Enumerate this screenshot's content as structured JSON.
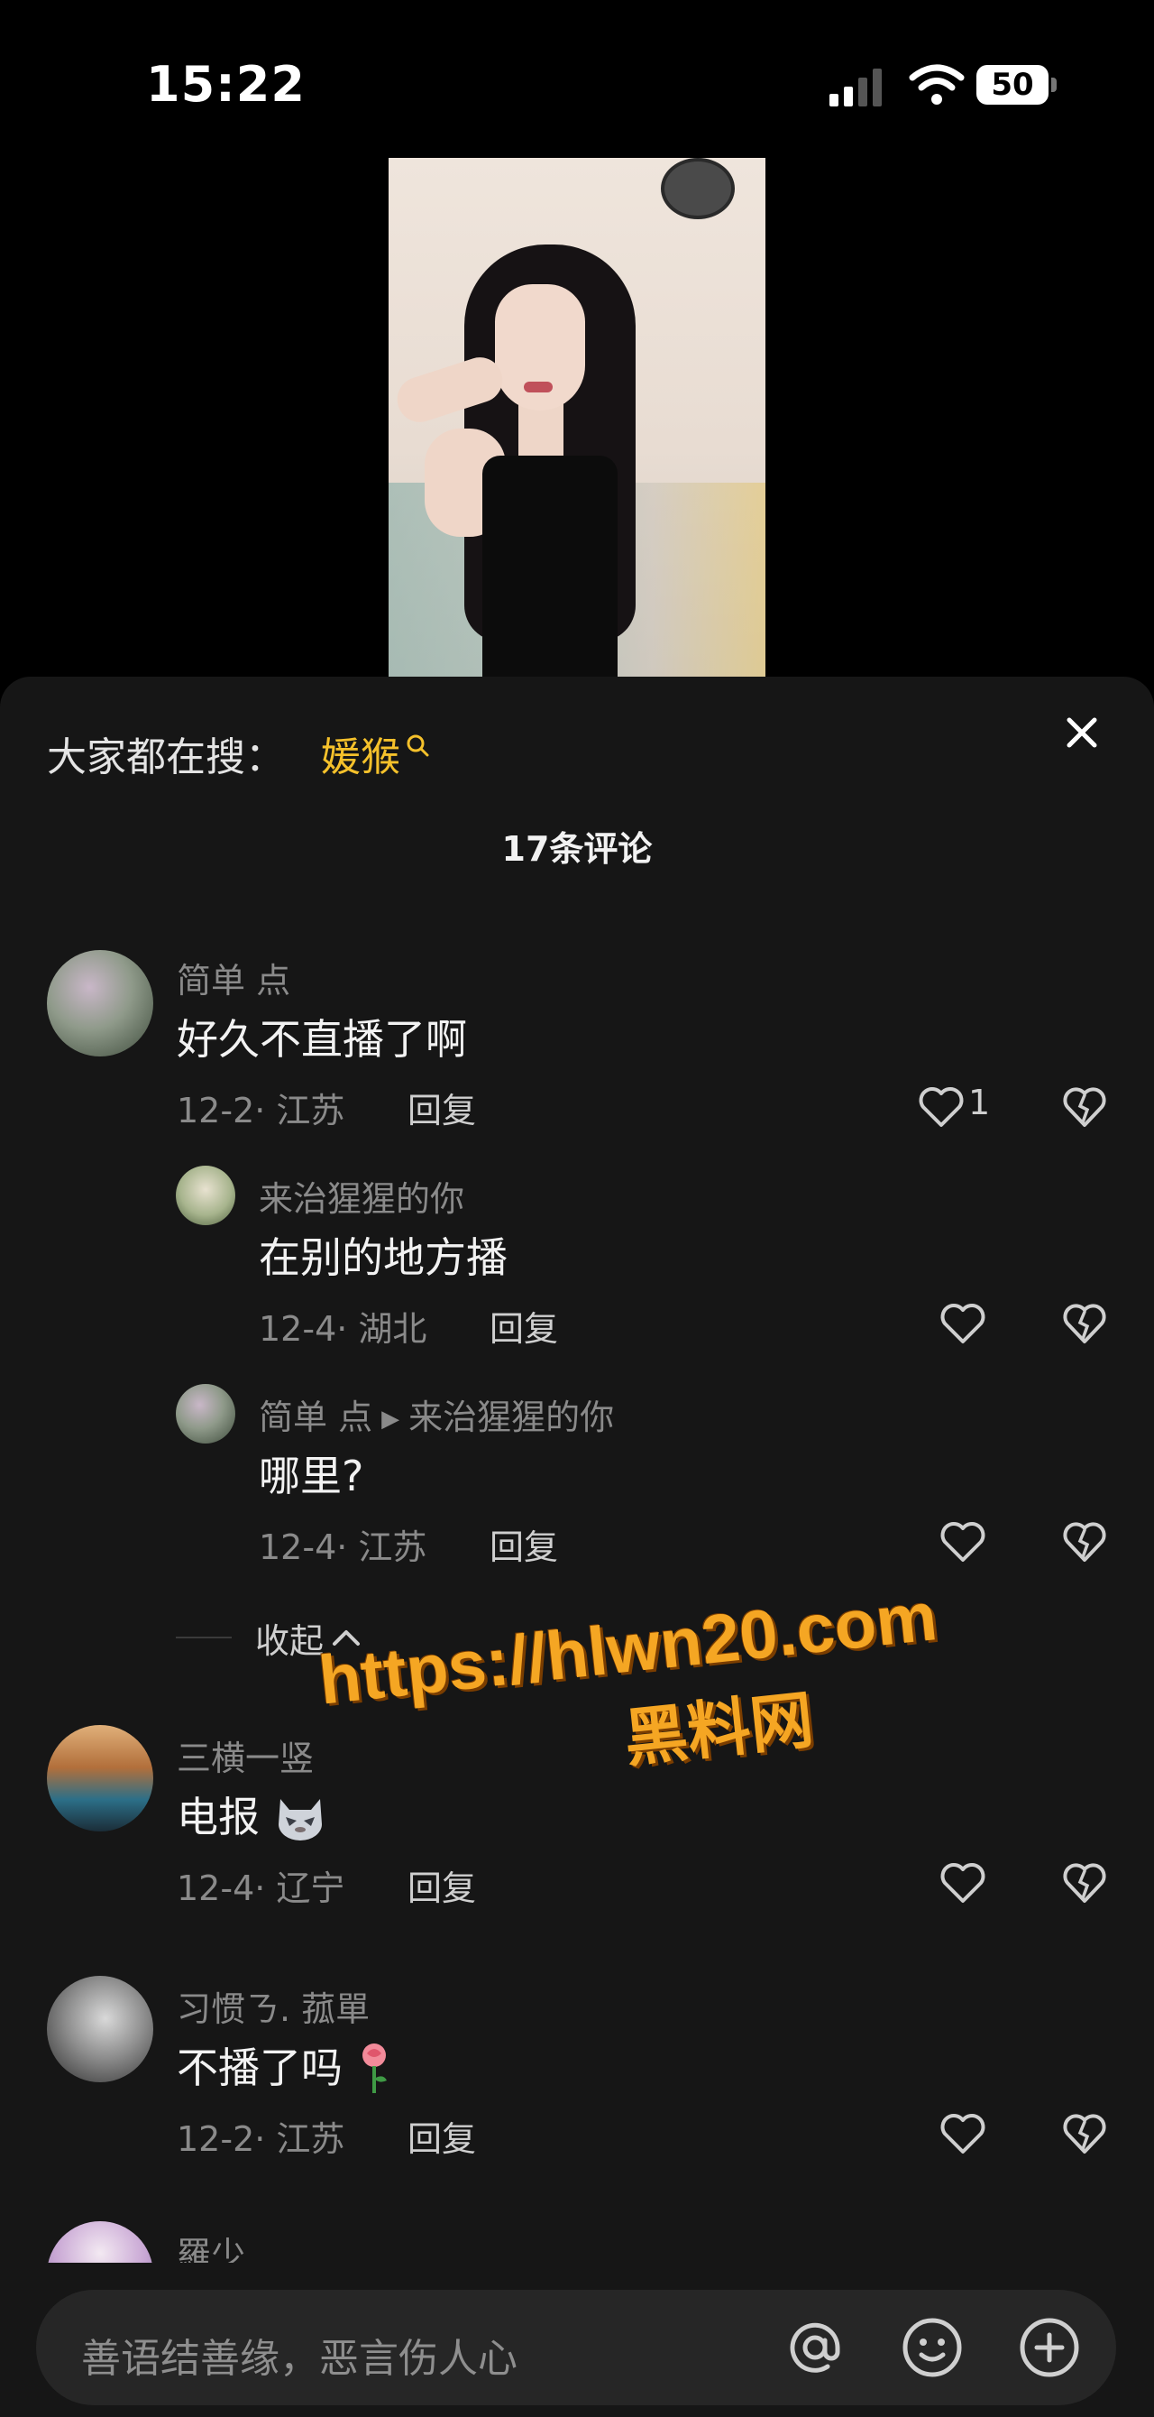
{
  "status": {
    "time": "15:22",
    "battery": "50"
  },
  "search": {
    "prefix": "大家都在搜：",
    "term": "媛猴"
  },
  "comments_count": "17条评论",
  "comments": [
    {
      "user": "简单 点",
      "text": "好久不直播了啊",
      "date": "12-2",
      "region": "江苏",
      "reply": "回复",
      "likes": "1"
    },
    {
      "user": "来治猩猩的你",
      "text": "在别的地方播",
      "date": "12-4",
      "region": "湖北",
      "reply": "回复"
    },
    {
      "user": "简单 点",
      "reply_to": "来治猩猩的你",
      "text": "哪里?",
      "date": "12-4",
      "region": "江苏",
      "reply": "回复"
    },
    {
      "user": "三横一竖",
      "text": "电报",
      "date": "12-4",
      "region": "辽宁",
      "reply": "回复"
    },
    {
      "user": "习惯ㄋ.   菰單",
      "text": "不播了吗",
      "date": "12-2",
      "region": "江苏",
      "reply": "回复"
    },
    {
      "user": "羅少"
    }
  ],
  "collapse_label": "收起",
  "input": {
    "placeholder": "善语结善缘，恶言伤人心"
  },
  "watermark": {
    "url": "https://hlwn20.com",
    "site": "黑料网"
  },
  "colors": {
    "accent": "#f5c12b",
    "sheet_bg": "#161616",
    "muted": "#8a8a8a"
  }
}
